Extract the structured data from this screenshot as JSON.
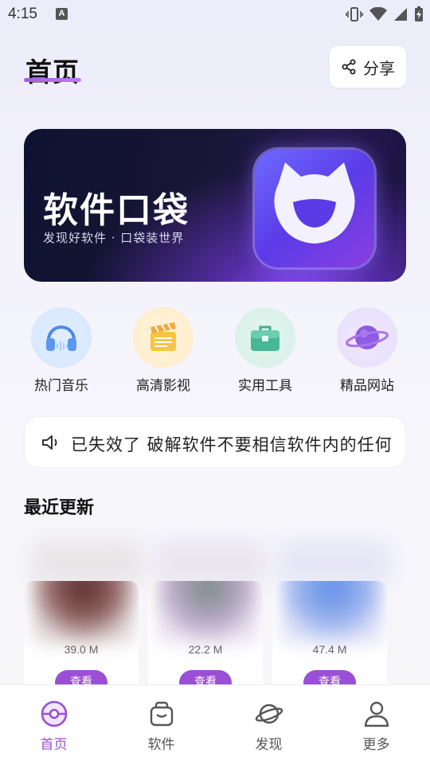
{
  "status_bar": {
    "time": "4:15",
    "notification_letter": "A"
  },
  "header": {
    "title": "首页",
    "share_label": "分享"
  },
  "banner": {
    "title": "软件口袋",
    "subtitle": "发现好软件 · 口袋装世界"
  },
  "quick_links": [
    {
      "label": "热门音乐",
      "icon": "headphones-icon"
    },
    {
      "label": "高清影视",
      "icon": "clapperboard-icon"
    },
    {
      "label": "实用工具",
      "icon": "toolbox-icon"
    },
    {
      "label": "精品网站",
      "icon": "planet-icon"
    }
  ],
  "notice": {
    "text": "已失效了   破解软件不要相信软件内的任何",
    "icon": "speaker-icon"
  },
  "recent": {
    "title": "最近更新",
    "items": [
      {
        "size": "39.0 M",
        "button": "查看"
      },
      {
        "size": "22.2 M",
        "button": "查看"
      },
      {
        "size": "47.4 M",
        "button": "查看"
      }
    ]
  },
  "nav": [
    {
      "label": "首页",
      "icon": "home-icon",
      "active": true
    },
    {
      "label": "软件",
      "icon": "bag-icon",
      "active": false
    },
    {
      "label": "发现",
      "icon": "planet-icon",
      "active": false
    },
    {
      "label": "更多",
      "icon": "user-icon",
      "active": false
    }
  ],
  "colors": {
    "accent": "#9A4FD4",
    "banner_bg": "#181634"
  }
}
